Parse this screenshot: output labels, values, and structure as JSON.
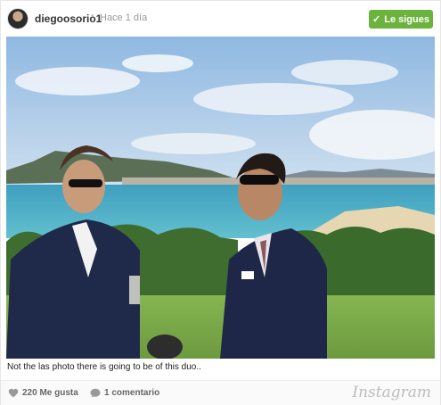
{
  "header": {
    "username": "diegoosorio1",
    "separator": "•",
    "time": "Hace 1 día",
    "follow_label": "Le sigues",
    "follow_check": "✓"
  },
  "photo": {
    "description_icon": "photo"
  },
  "caption": "Not the las photo there is going to be of this duo..",
  "footer": {
    "likes": "220 Me gusta",
    "comments": "1 comentario",
    "brand": "Instagram"
  },
  "colors": {
    "follow_button": "#6cb33e",
    "sky": "#9fc3e6",
    "sea": "#4fb0c8",
    "grass": "#7aa84a"
  }
}
